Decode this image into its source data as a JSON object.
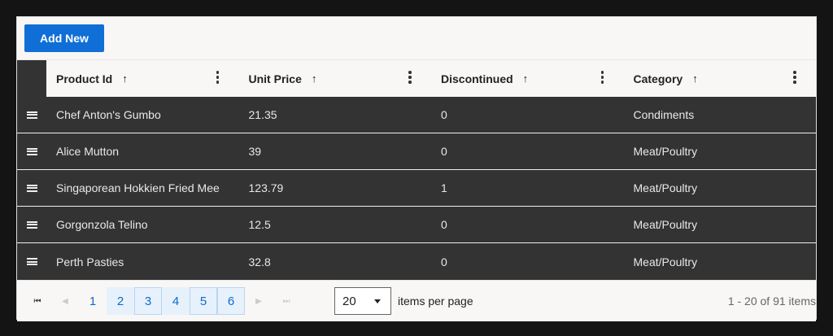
{
  "toolbar": {
    "add_label": "Add New"
  },
  "columns": [
    {
      "label": "Product Id",
      "sort": "↑"
    },
    {
      "label": "Unit Price",
      "sort": "↑"
    },
    {
      "label": "Discontinued",
      "sort": "↑"
    },
    {
      "label": "Category",
      "sort": "↑"
    }
  ],
  "rows": [
    [
      "Chef Anton's Gumbo",
      "21.35",
      "0",
      "Condiments"
    ],
    [
      "Alice Mutton",
      "39",
      "0",
      "Meat/Poultry"
    ],
    [
      "Singaporean Hokkien Fried Mee",
      "123.79",
      "1",
      "Meat/Poultry"
    ],
    [
      "Gorgonzola Telino",
      "12.5",
      "0",
      "Meat/Poultry"
    ],
    [
      "Perth Pasties",
      "32.8",
      "0",
      "Meat/Poultry"
    ]
  ],
  "pager": {
    "first_icon": "⏮",
    "prev_icon": "◀",
    "next_icon": "▶",
    "last_icon": "⏭",
    "pages": [
      "1",
      "2",
      "3",
      "4",
      "5",
      "6"
    ],
    "page_size": "20",
    "items_per_page_label": "items per page",
    "info": "1 - 20 of 91 items"
  },
  "colors": {
    "accent": "#0f6fd6",
    "row_bg": "#333333",
    "page_bg": "#f8f7f5"
  }
}
